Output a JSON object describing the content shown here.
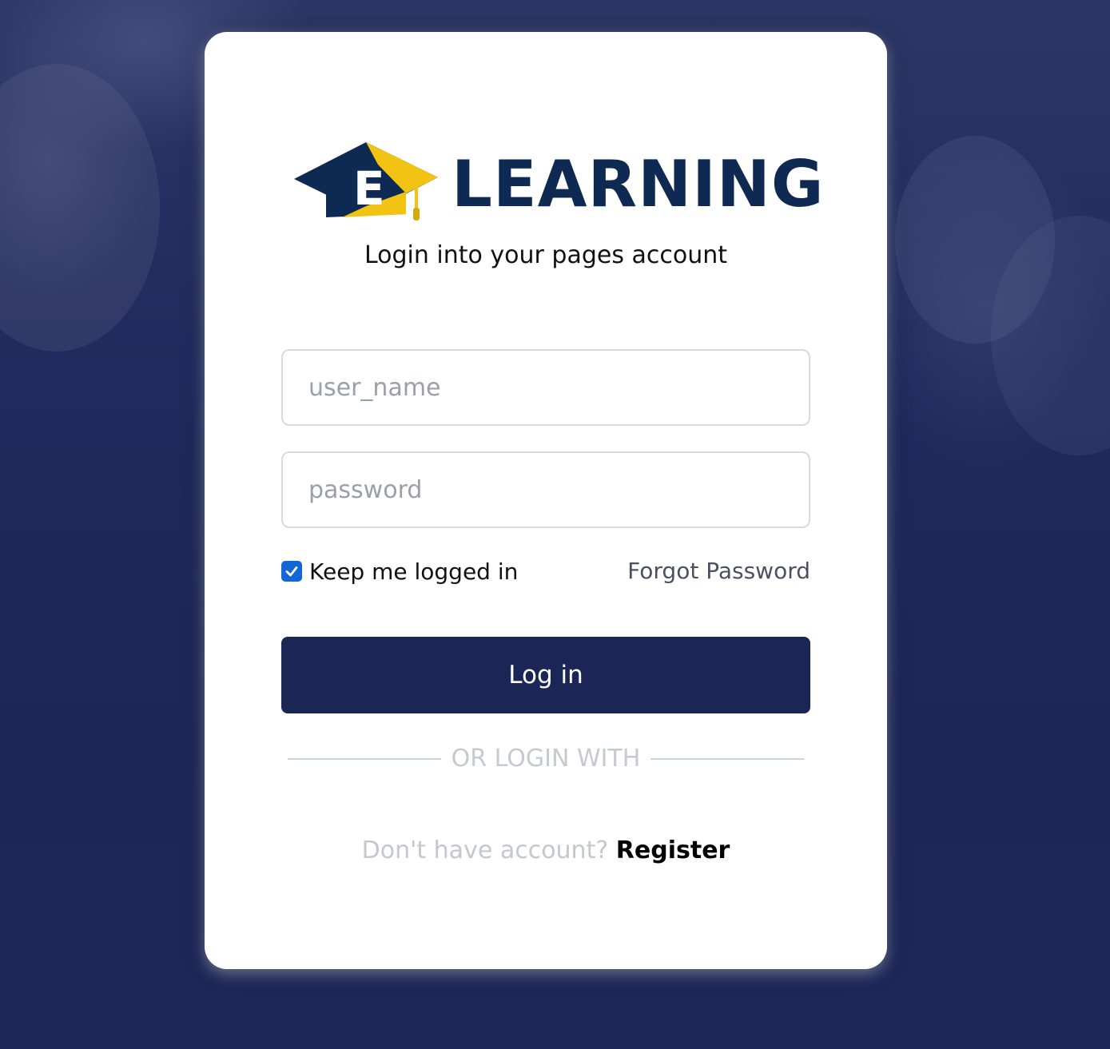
{
  "brand": {
    "logo_letter": "E",
    "logo_text": "LEARNING",
    "primary_color": "#0e2a52",
    "accent_color": "#f2c312"
  },
  "login": {
    "subtitle": "Login into your pages account",
    "username_placeholder": "user_name",
    "password_placeholder": "password",
    "keep_logged_in_label": "Keep me logged in",
    "keep_logged_in_checked": true,
    "forgot_password_label": "Forgot Password",
    "login_button_label": "Log in",
    "divider_text": "OR LOGIN WITH",
    "no_account_text": "Don't have account?",
    "register_label": "Register"
  },
  "colors": {
    "button_bg": "#1b2656",
    "checkbox": "#1366d6",
    "background": "#1f2b5e"
  }
}
